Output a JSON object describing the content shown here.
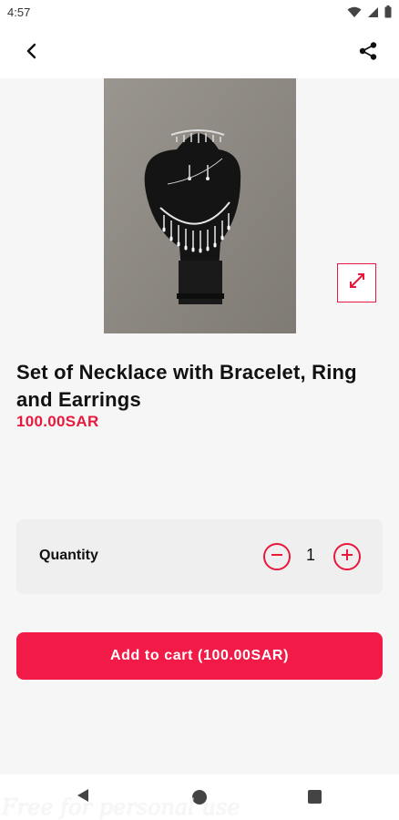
{
  "status_bar": {
    "time": "4:57",
    "icons": [
      "wifi-icon",
      "signal-icon",
      "battery-icon"
    ]
  },
  "app_bar": {
    "back_icon": "chevron-left-icon",
    "share_icon": "share-icon"
  },
  "product": {
    "image_alt": "necklace-set-photo",
    "expand_icon": "expand-icon",
    "title": "Set of Necklace with Bracelet, Ring and Earrings",
    "price": "100.00SAR"
  },
  "quantity": {
    "label": "Quantity",
    "value": "1",
    "minus_icon": "minus-circle-icon",
    "plus_icon": "plus-circle-icon"
  },
  "cart": {
    "button_label": "Add to cart (100.00SAR)"
  },
  "nav_bar": {
    "icons": [
      "nav-back-icon",
      "nav-home-icon",
      "nav-recents-icon"
    ]
  },
  "watermark": "Free for personal use",
  "colors": {
    "accent": "#e8193c",
    "button": "#f21a46",
    "background": "#f6f6f6"
  }
}
